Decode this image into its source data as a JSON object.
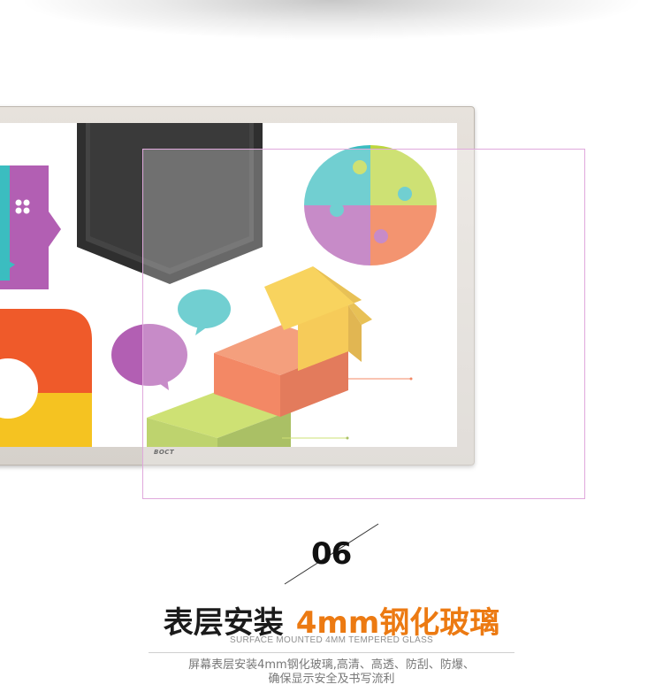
{
  "brand": "BOCT",
  "section_number": "06",
  "title": {
    "main": "表层安装",
    "accent": "4mm钢化玻璃"
  },
  "subtitle": "SURFACE MOUNTED 4MM TEMPERED GLASS",
  "description": {
    "line1": "屏幕表层安装4mm钢化玻璃,高清、高透、防刮、防爆、",
    "line2": "确保显示安全及书写流利"
  },
  "colors": {
    "accent": "#ec7a12",
    "purple": "#b25fb3",
    "teal": "#3bbdc0",
    "lime": "#bcd63f",
    "orange": "#ef6b3a",
    "yellow": "#f5c321",
    "glass_border": "#e0a9dc"
  }
}
